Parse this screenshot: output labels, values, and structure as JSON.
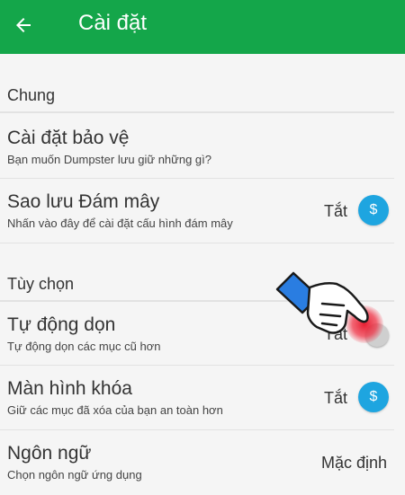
{
  "appbar": {
    "title": "Cài đặt",
    "back_icon": "arrow-left-icon"
  },
  "sections": [
    {
      "label": "Chung"
    },
    {
      "label": "Tùy chọn"
    }
  ],
  "rows": {
    "protection": {
      "title": "Cài đặt bảo vệ",
      "subtitle": "Bạn muốn Dumpster lưu giữ những gì?"
    },
    "cloud": {
      "title": "Sao lưu Đám mây",
      "subtitle": "Nhấn vào đây để cài đặt cấu hình đám mây",
      "value": "Tắt",
      "badge": "$"
    },
    "autoclean": {
      "title": "Tự động dọn",
      "subtitle": "Tự động dọn các mục cũ hơn",
      "value": "Tắt"
    },
    "lockscreen": {
      "title": "Màn hình khóa",
      "subtitle": "Giữ các mục đã xóa của bạn an toàn hơn",
      "value": "Tắt",
      "badge": "$"
    },
    "language": {
      "title": "Ngôn ngữ",
      "subtitle": "Chọn ngôn ngữ ứng dụng",
      "value": "Mặc định"
    }
  },
  "colors": {
    "appbar": "#14a64a",
    "badge": "#1ea5e0",
    "tap": "#e61428"
  }
}
